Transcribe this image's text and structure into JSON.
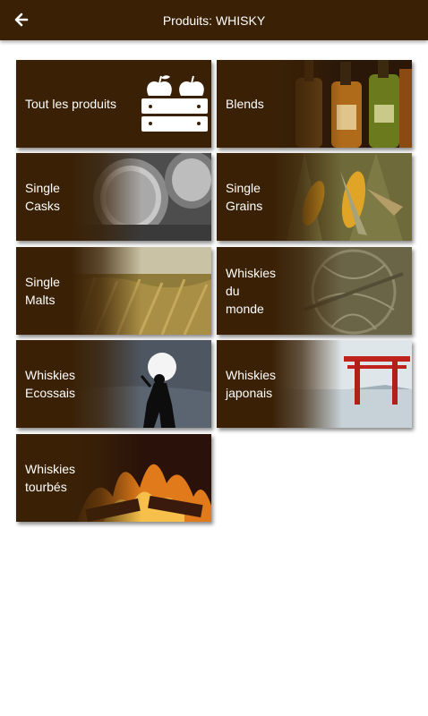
{
  "header": {
    "title": "Produits: WHISKY",
    "back_icon": "arrow-left-icon"
  },
  "colors": {
    "brand_brown": "#3a2106",
    "text": "#ffffff",
    "background": "#ffffff"
  },
  "categories": [
    {
      "label": "Tout les produits",
      "icon": "crate-with-apples-icon"
    },
    {
      "label": "Blends",
      "image": "whisky-bottles-photo"
    },
    {
      "label": "Single\nCasks",
      "image": "whisky-barrels-photo"
    },
    {
      "label": "Single\nGrains",
      "image": "corn-cobs-photo"
    },
    {
      "label": "Single\nMalts",
      "image": "barley-field-photo"
    },
    {
      "label": "Whiskies\ndu\nmonde",
      "image": "globe-engraving-photo"
    },
    {
      "label": "Whiskies\nEcossais",
      "image": "bagpiper-silhouette-photo"
    },
    {
      "label": "Whiskies\njaponais",
      "image": "torii-gate-lake-photo"
    },
    {
      "label": "Whiskies\ntourbés",
      "image": "peat-fire-photo"
    }
  ]
}
